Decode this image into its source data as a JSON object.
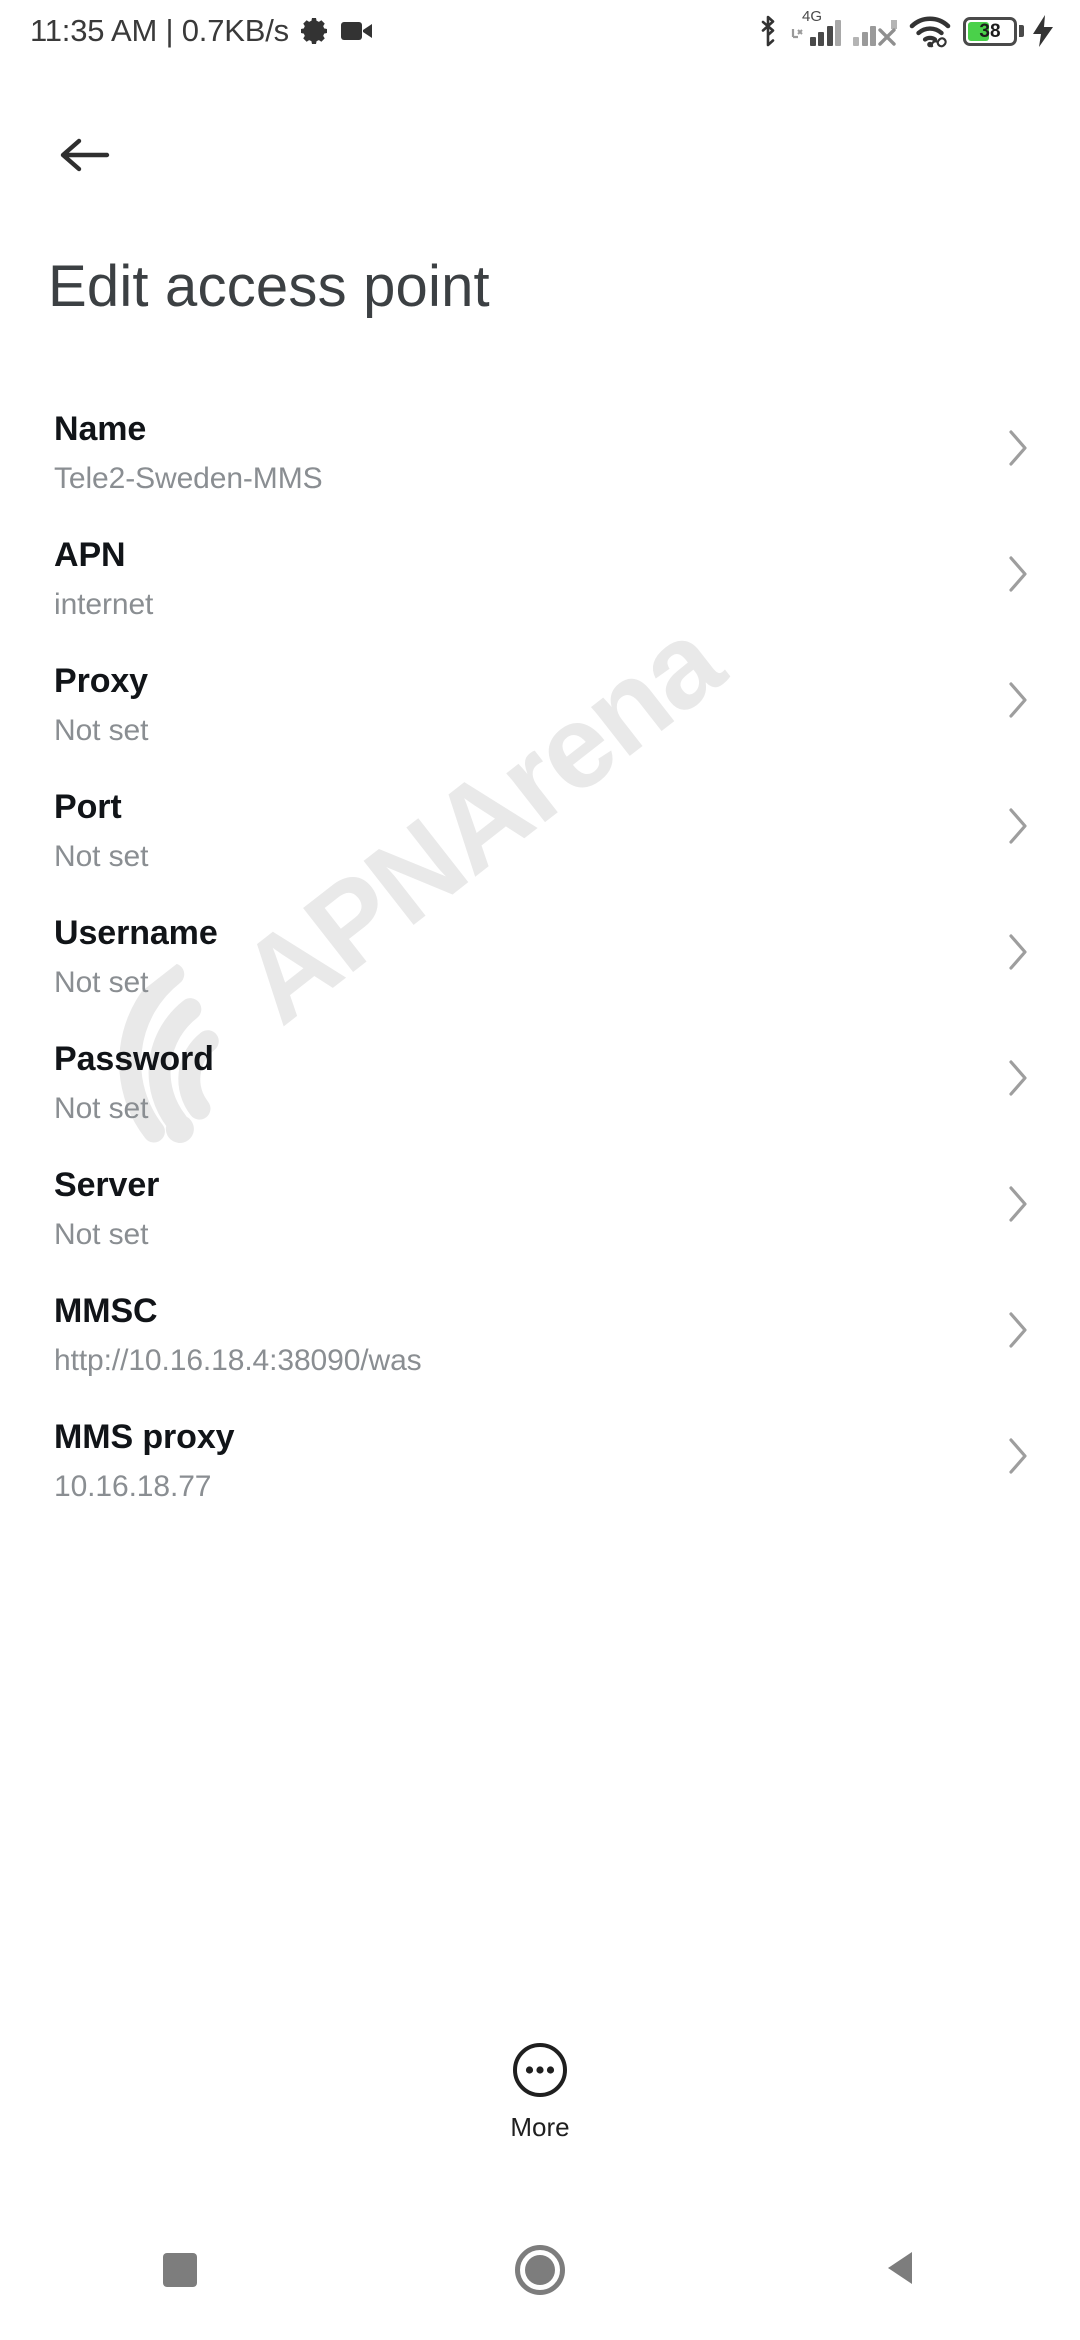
{
  "statusbar": {
    "clock": "11:35 AM | 0.7KB/s",
    "gear_icon": "gear-icon",
    "camera_icon": "video-camera-icon",
    "bluetooth_icon": "bluetooth-icon",
    "network_type": "4G",
    "sim1_icon": "cellular-signal-sim1-icon",
    "sim2_icon": "cellular-signal-sim2-no-service-icon",
    "wifi_icon": "wifi-icon",
    "battery_level": "38",
    "battery_icon": "battery-icon",
    "charging_icon": "charging-bolt-icon",
    "battery_fill_color": "#4ad14a"
  },
  "header": {
    "back_icon": "back-arrow-icon",
    "title": "Edit access point"
  },
  "watermark": {
    "text": "APNArena",
    "logo_icon": "wifi-arc-logo-icon",
    "color": "#e9e9e9"
  },
  "list": {
    "chevron_icon": "chevron-right-icon",
    "rows": [
      {
        "title": "Name",
        "value": "Tele2-Sweden-MMS"
      },
      {
        "title": "APN",
        "value": "internet"
      },
      {
        "title": "Proxy",
        "value": "Not set"
      },
      {
        "title": "Port",
        "value": "Not set"
      },
      {
        "title": "Username",
        "value": "Not set"
      },
      {
        "title": "Password",
        "value": "Not set"
      },
      {
        "title": "Server",
        "value": "Not set"
      },
      {
        "title": "MMSC",
        "value": "http://10.16.18.4:38090/was"
      },
      {
        "title": "MMS proxy",
        "value": "10.16.18.77"
      }
    ]
  },
  "more": {
    "label": "More",
    "icon": "more-circle-icon"
  },
  "navbar": {
    "recents_icon": "recents-square-icon",
    "home_icon": "home-circle-icon",
    "back_icon": "back-triangle-icon"
  }
}
